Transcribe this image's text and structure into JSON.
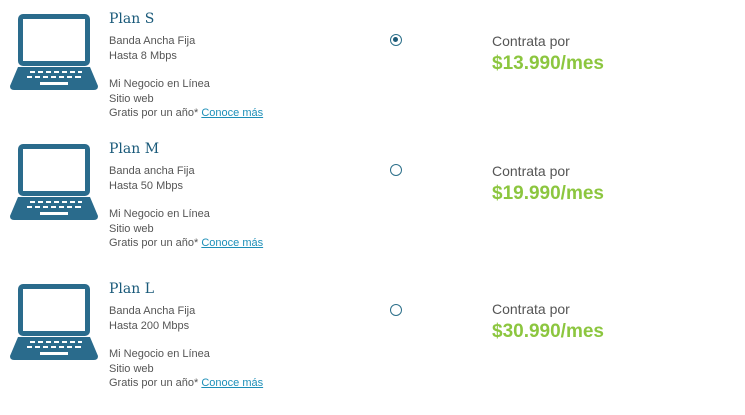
{
  "plans": [
    {
      "name": "Plan S",
      "line1": "Banda Ancha Fija",
      "line2": "Hasta 8 Mbps",
      "line3": "Mi Negocio en Línea",
      "line4": "Sitio web",
      "line5": "Gratis por un año*",
      "link": "Conoce más",
      "selected": true,
      "price_label": "Contrata por",
      "price": "$13.990/mes"
    },
    {
      "name": "Plan M",
      "line1": "Banda ancha Fija",
      "line2": "Hasta 50 Mbps",
      "line3": "Mi Negocio en Línea",
      "line4": "Sitio web",
      "line5": "Gratis por un año*",
      "link": "Conoce más",
      "selected": false,
      "price_label": "Contrata por",
      "price": "$19.990/mes"
    },
    {
      "name": "Plan L",
      "line1": "Banda Ancha Fija",
      "line2": "Hasta 200 Mbps",
      "line3": "Mi Negocio en Línea",
      "line4": "Sitio web",
      "line5": "Gratis por un año*",
      "link": "Conoce más",
      "selected": false,
      "price_label": "Contrata por",
      "price": "$30.990/mes"
    }
  ],
  "colors": {
    "plan_title": "#1a5a7a",
    "laptop": "#2a6b8c",
    "price": "#8cc63f",
    "link": "#1d8fb8"
  },
  "icons": {
    "plan_icon": "laptop-icon"
  }
}
